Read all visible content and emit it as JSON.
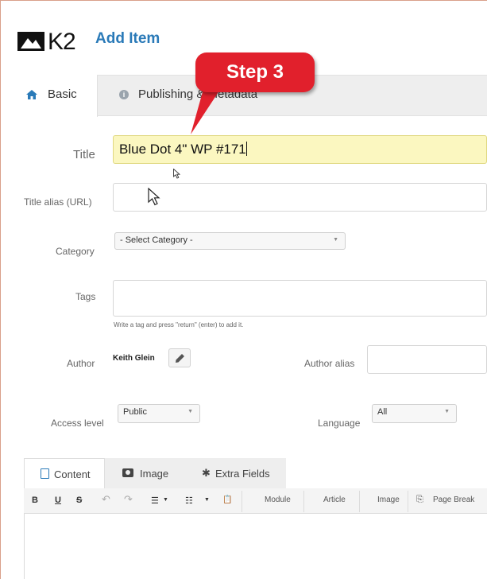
{
  "header": {
    "logo_text": "K2",
    "page_title": "Add Item"
  },
  "tabs": [
    {
      "label": "Basic",
      "icon": "home-icon",
      "active": true
    },
    {
      "label": "Publishing & Metadata",
      "icon": "info-icon",
      "active": false
    }
  ],
  "annotation": {
    "label": "Step 3",
    "color": "#e1202c"
  },
  "form": {
    "title_label": "Title",
    "title_value": "Blue Dot 4\" WP #171",
    "alias_label": "Title alias (URL)",
    "alias_value": "",
    "category_label": "Category",
    "category_value": "- Select Category -",
    "tags_label": "Tags",
    "tags_help": "Write a tag and press \"return\" (enter) to add it.",
    "author_label": "Author",
    "author_name": "Keith Glein",
    "author_alias_label": "Author alias",
    "access_label": "Access level",
    "access_value": "Public",
    "language_label": "Language",
    "language_value": "All"
  },
  "editor": {
    "tabs": [
      {
        "label": "Content",
        "icon": "document-icon",
        "active": true
      },
      {
        "label": "Image",
        "icon": "camera-icon",
        "active": false
      },
      {
        "label": "Extra Fields",
        "icon": "gear-icon",
        "active": false
      }
    ],
    "toolbar": {
      "bold": "B",
      "underline": "U",
      "strike": "S",
      "undo": "↶",
      "redo": "↷",
      "bullets": "☰",
      "numbered": "☷",
      "paste": "📋",
      "module": "Module",
      "article": "Article",
      "image": "Image",
      "page_break": "Page Break"
    }
  },
  "colors": {
    "accent": "#2a7ab8",
    "title_field_bg": "#fbf7c0",
    "tab_bar_bg": "#eeeeee"
  }
}
